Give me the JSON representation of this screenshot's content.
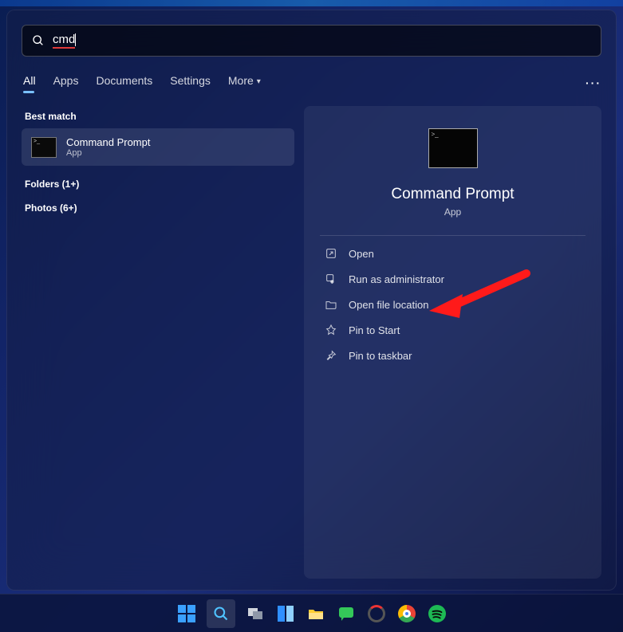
{
  "search": {
    "query": "cmd"
  },
  "tabs": {
    "items": [
      "All",
      "Apps",
      "Documents",
      "Settings"
    ],
    "more": "More",
    "active": 0
  },
  "left": {
    "best_match_label": "Best match",
    "result": {
      "title": "Command Prompt",
      "subtitle": "App"
    },
    "categories": [
      {
        "label": "Folders (1+)"
      },
      {
        "label": "Photos (6+)"
      }
    ]
  },
  "right": {
    "title": "Command Prompt",
    "subtitle": "App",
    "actions": [
      {
        "icon": "open",
        "label": "Open"
      },
      {
        "icon": "admin",
        "label": "Run as administrator"
      },
      {
        "icon": "folder",
        "label": "Open file location"
      },
      {
        "icon": "pin-start",
        "label": "Pin to Start"
      },
      {
        "icon": "pin-task",
        "label": "Pin to taskbar"
      }
    ]
  },
  "taskbar": {
    "items": [
      "start",
      "search",
      "taskview",
      "widgets",
      "explorer",
      "chat",
      "app1",
      "chrome",
      "spotify"
    ],
    "active": "search"
  },
  "annotation": {
    "arrow_target_action_index": 1
  }
}
